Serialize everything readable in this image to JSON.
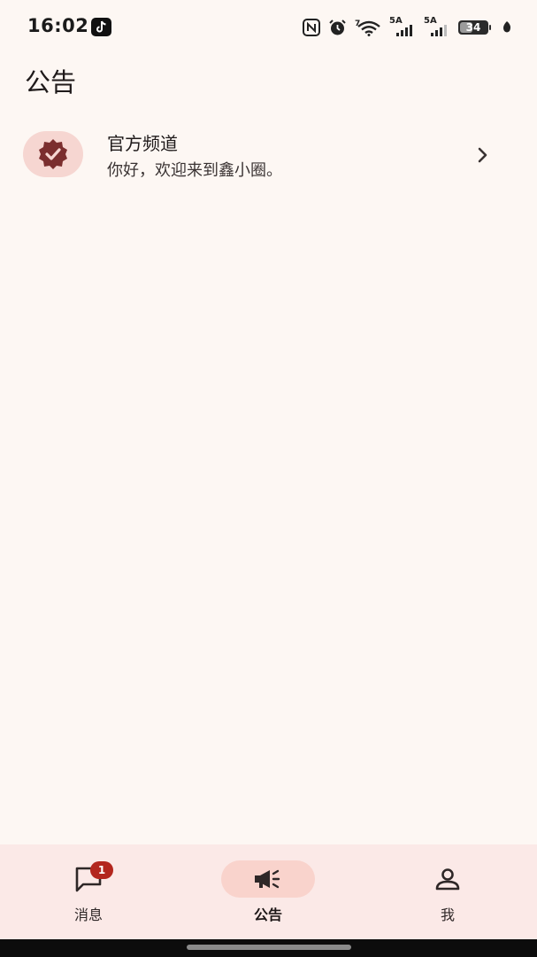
{
  "status_bar": {
    "time": "16:02",
    "network_1": "5A",
    "network_2": "5A",
    "battery_level": "34",
    "icons": [
      "tiktok-icon",
      "nfc-icon",
      "alarm-icon",
      "wifi-icon",
      "signal-icon",
      "signal-icon",
      "battery-icon",
      "leaf-icon"
    ]
  },
  "header": {
    "title": "公告"
  },
  "channel": {
    "title": "官方频道",
    "subtitle": "你好，欢迎来到鑫小圈。",
    "icon": "verified-badge-icon"
  },
  "bottom_nav": {
    "items": [
      {
        "label": "消息",
        "icon": "chat-bubble-icon",
        "badge": "1",
        "active": false
      },
      {
        "label": "公告",
        "icon": "megaphone-icon",
        "active": true
      },
      {
        "label": "我",
        "icon": "person-icon",
        "active": false
      }
    ]
  },
  "colors": {
    "background": "#fdf7f3",
    "nav_background": "#fbe9e7",
    "accent": "#f9d3cc",
    "badge": "#b3261e",
    "icon_dark": "#7b2e2e"
  }
}
